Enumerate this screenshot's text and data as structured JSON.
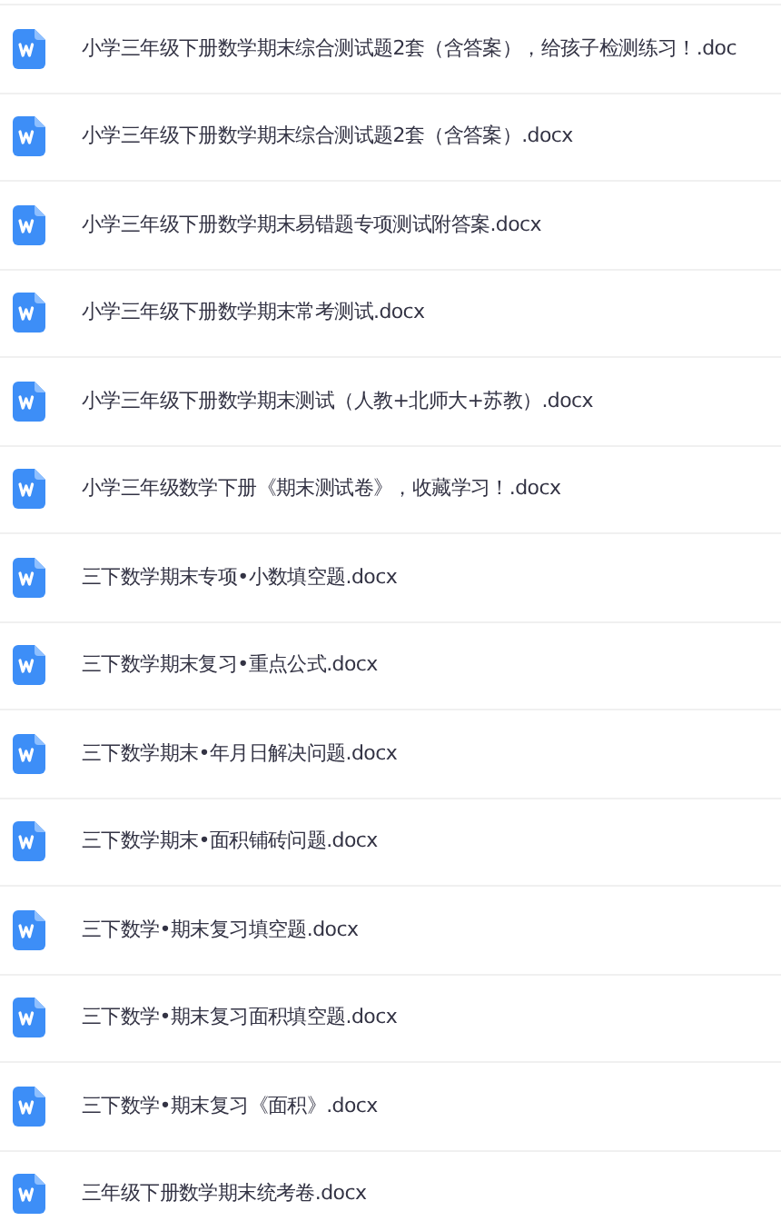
{
  "files": [
    {
      "name": "小学三年级下册数学期末综合测试题2套（含答案），给孩子检测练习！.doc"
    },
    {
      "name": "小学三年级下册数学期末综合测试题2套（含答案）.docx"
    },
    {
      "name": "小学三年级下册数学期末易错题专项测试附答案.docx"
    },
    {
      "name": "小学三年级下册数学期末常考测试.docx"
    },
    {
      "name": "小学三年级下册数学期末测试（人教+北师大+苏教）.docx"
    },
    {
      "name": "小学三年级数学下册《期末测试卷》，收藏学习！.docx"
    },
    {
      "name": "三下数学期末专项•小数填空题.docx"
    },
    {
      "name": "三下数学期末复习•重点公式.docx"
    },
    {
      "name": "三下数学期末•年月日解决问题.docx"
    },
    {
      "name": "三下数学期末•面积铺砖问题.docx"
    },
    {
      "name": "三下数学•期末复习填空题.docx"
    },
    {
      "name": "三下数学•期末复习面积填空题.docx"
    },
    {
      "name": "三下数学•期末复习《面积》.docx"
    },
    {
      "name": "三年级下册数学期末统考卷.docx"
    }
  ]
}
